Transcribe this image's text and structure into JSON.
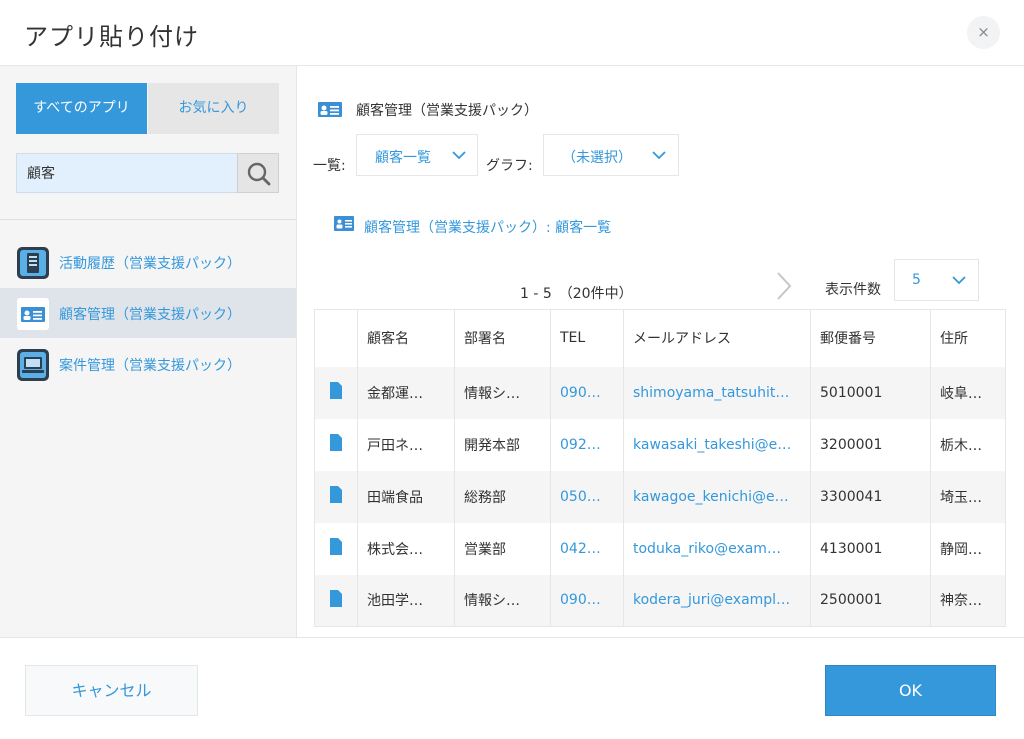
{
  "dialog": {
    "title": "アプリ貼り付け",
    "close_label": "×"
  },
  "left_panel": {
    "tabs": [
      {
        "label": "すべてのアプリ",
        "active": true
      },
      {
        "label": "お気に入り",
        "active": false
      }
    ],
    "search": {
      "value": "顧客",
      "placeholder": ""
    },
    "apps": [
      {
        "label": "活動履歴（営業支援パック）",
        "icon": "activity-app-icon",
        "selected": false
      },
      {
        "label": "顧客管理（営業支援パック）",
        "icon": "customer-app-icon",
        "selected": true
      },
      {
        "label": "案件管理（営業支援パック）",
        "icon": "deal-app-icon",
        "selected": false
      }
    ]
  },
  "right_panel": {
    "app_name": "顧客管理（営業支援パック）",
    "view_label": "一覧:",
    "view_selected": "顧客一覧",
    "graph_label": "グラフ:",
    "graph_selected": "（未選択）",
    "link_text": "顧客管理（営業支援パック）: 顧客一覧",
    "pager_text": "1 - 5　（20件中）",
    "per_page_label": "表示件数",
    "per_page_value": "5",
    "table": {
      "columns": [
        "",
        "顧客名",
        "部署名",
        "TEL",
        "メールアドレス",
        "郵便番号",
        "住所"
      ],
      "rows": [
        [
          "金都運…",
          "情報シ…",
          "090…",
          "shimoyama_tatsuhit…",
          "5010001",
          "岐阜…"
        ],
        [
          "戸田ネ…",
          "開発本部",
          "092…",
          "kawasaki_takeshi@e…",
          "3200001",
          "栃木…"
        ],
        [
          "田端食品",
          "総務部",
          "050…",
          "kawagoe_kenichi@e…",
          "3300041",
          "埼玉…"
        ],
        [
          "株式会…",
          "営業部",
          "042…",
          "toduka_riko@exam…",
          "4130001",
          "静岡…"
        ],
        [
          "池田学…",
          "情報シ…",
          "090…",
          "kodera_juri@exampl…",
          "2500001",
          "神奈…"
        ]
      ]
    }
  },
  "footer": {
    "cancel_label": "キャンセル",
    "ok_label": "OK"
  },
  "colors": {
    "accent": "#3498db",
    "search_bg": "#e2f0fd",
    "selected_row": "#dfe4ea"
  }
}
